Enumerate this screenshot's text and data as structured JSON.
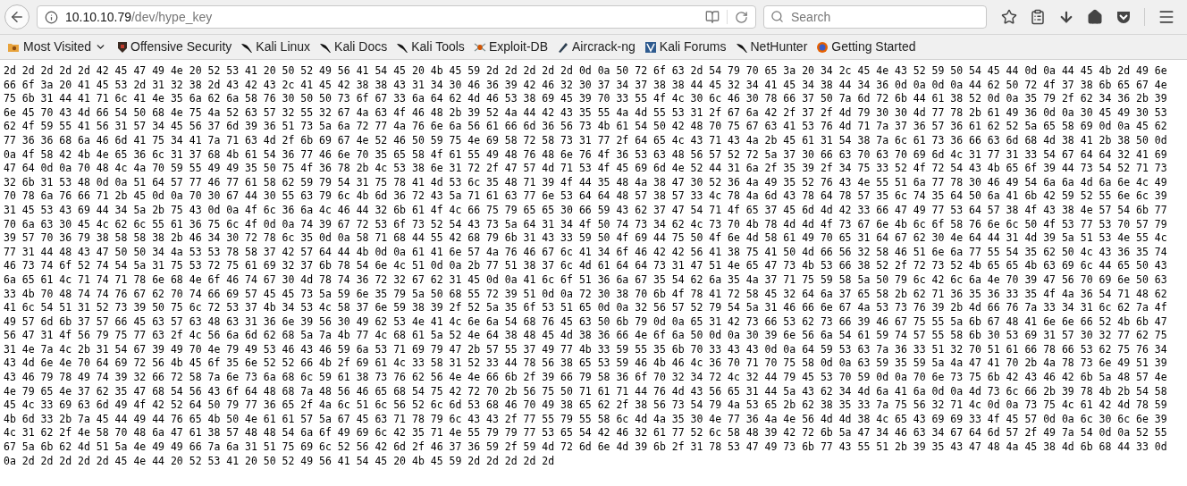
{
  "toolbar": {
    "url_host": "10.10.10.79",
    "url_path": "/dev/hype_key",
    "search_placeholder": "Search"
  },
  "bookmarks": [
    {
      "kind": "folder",
      "label": "Most Visited"
    },
    {
      "kind": "link",
      "label": "Offensive Security"
    },
    {
      "kind": "link",
      "label": "Kali Linux"
    },
    {
      "kind": "link",
      "label": "Kali Docs"
    },
    {
      "kind": "link",
      "label": "Kali Tools"
    },
    {
      "kind": "link",
      "label": "Exploit-DB"
    },
    {
      "kind": "link",
      "label": "Aircrack-ng"
    },
    {
      "kind": "link",
      "label": "Kali Forums"
    },
    {
      "kind": "link",
      "label": "NetHunter"
    },
    {
      "kind": "link",
      "label": "Getting Started"
    }
  ],
  "content_lines": [
    "2d 2d 2d 2d 2d 42 45 47 49 4e 20 52 53 41 20 50 52 49 56 41 54 45 20 4b 45 59 2d 2d 2d 2d 2d 0d 0a 50 72 6f 63 2d 54 79 70 65 3a 20 34 2c 45 4e 43 52 59 50 54 45 44 0d 0a 44 45 4b 2d 49 6e",
    "66 6f 3a 20 41 45 53 2d 31 32 38 2d 43 42 43 2c 41 45 42 38 38 43 31 34 30 46 36 39 42 46 32 30 37 34 37 38 38 44 45 32 34 41 45 34 38 44 34 36 0d 0a 0d 0a 44 62 50 72 4f 37 38 6b 65 67 4e",
    "75 6b 31 44 41 71 6c 41 4e 35 6a 62 6a 58 76 30 50 50 73 6f 67 33 6a 64 62 4d 46 53 38 69 45 39 70 33 55 4f 4c 30 6c 46 30 78 66 37 50 7a 6d 72 6b 44 61 38 52 0d 0a 35 79 2f 62 34 36 2b 39",
    "6e 45 70 43 4d 66 54 50 68 4e 75 4a 52 63 57 32 55 32 67 4a 63 4f 46 48 2b 39 52 4a 44 42 43 35 55 4a 4d 55 53 31 2f 67 6a 42 2f 37 2f 4d 79 30 30 4d 77 78 2b 61 49 36 0d 0a 30 45 49 30 53",
    "62 4f 59 55 41 56 31 57 34 45 56 37 6d 39 36 51 73 5a 6a 72 77 4a 76 6e 6a 56 61 66 6d 36 56 73 4b 61 54 50 42 48 70 75 67 63 41 53 76 4d 71 7a 37 36 57 36 61 62 52 5a 65 58 69 0d 0a 45 62",
    "77 36 36 68 6a 46 6d 41 75 34 41 7a 71 63 4d 2f 6b 69 67 4e 52 46 50 59 75 4e 69 58 72 58 73 31 77 2f 64 65 4c 43 71 43 4a 2b 45 61 31 54 38 7a 6c 61 73 36 66 63 6d 68 4d 38 41 2b 38 50 0d",
    "0a 4f 58 42 4b 4e 65 36 6c 31 37 68 4b 61 54 36 77 46 6e 70 35 65 58 4f 61 55 49 48 76 48 6e 76 4f 36 53 63 48 56 57 52 72 5a 37 30 66 63 70 63 70 69 6d 4c 31 77 31 33 54 67 64 64 32 41 69",
    "47 64 0d 0a 70 48 4c 4a 70 59 55 49 49 35 50 75 4f 36 78 2b 4c 53 38 6e 31 72 2f 47 57 4d 71 53 4f 45 69 6d 4e 52 44 31 6a 2f 35 39 2f 34 75 33 52 4f 72 54 43 4b 65 6f 39 44 73 54 52 71 73",
    "32 6b 31 53 48 0d 0a 51 64 57 77 46 77 61 58 62 59 79 54 31 75 78 41 4d 53 6c 35 48 71 39 4f 44 35 48 4a 38 47 30 52 36 4a 49 35 52 76 43 4e 55 51 6a 77 78 30 46 49 54 6a 6a 4d 6a 6e 4c 49",
    "70 78 6a 76 66 71 2b 45 0d 0a 70 30 67 44 30 55 63 79 6c 4b 6d 36 72 43 5a 71 61 63 77 6e 53 64 64 48 57 38 57 33 4c 78 4a 6d 43 78 64 78 57 35 6c 74 35 64 50 6a 41 6b 42 59 52 55 6e 6c 39",
    "31 45 53 43 69 44 34 5a 2b 75 43 0d 0a 4f 6c 36 6a 4c 46 44 32 6b 61 4f 4c 66 75 79 65 65 30 66 59 43 62 37 47 54 71 4f 65 37 45 6d 4d 42 33 66 47 49 77 53 64 57 38 4f 43 38 4e 57 54 6b 77",
    "70 6a 63 30 45 4c 62 6c 55 61 36 75 6c 4f 0d 0a 74 39 67 72 53 6f 73 52 54 43 73 5a 64 31 34 4f 50 74 73 34 62 4c 73 70 4b 78 4d 4d 4f 73 67 6e 4b 6c 6f 58 76 6e 6c 50 4f 53 77 53 70 57 79",
    "39 57 70 36 79 38 58 58 38 2b 46 34 30 72 78 6c 35 0d 0a 58 71 68 44 55 42 68 79 6b 31 43 33 59 50 4f 69 44 75 50 4f 6e 4d 58 61 49 70 65 31 64 67 62 30 4e 64 44 31 4d 39 5a 51 53 4e 55 4c",
    "77 31 44 48 43 47 50 50 34 4a 53 53 78 58 37 42 57 64 44 4b 0d 0a 61 41 6e 57 4a 76 46 67 6c 41 34 6f 46 42 42 56 41 38 75 41 50 4d 66 56 32 58 46 51 6e 6a 77 55 54 35 62 50 4c 43 36 35 74",
    "46 73 74 6f 52 74 54 5a 31 75 53 72 75 61 69 32 37 6b 78 54 6e 4c 51 0d 0a 2b 77 51 38 37 6c 4d 61 64 64 73 31 47 51 4e 65 47 73 4b 53 66 38 52 2f 72 73 52 4b 65 65 4b 63 69 6c 44 65 50 43",
    "6a 65 61 4c 71 74 71 78 6e 68 4e 6f 46 74 67 30 4d 78 74 36 72 32 67 62 31 45 0d 0a 41 6c 6f 51 36 6a 67 35 54 62 6a 35 4a 37 71 75 59 58 5a 50 79 6c 42 6c 6a 4e 70 39 47 56 70 69 6e 50 63",
    "33 4b 70 48 74 74 76 67 62 70 74 66 69 57 45 45 73 5a 59 6e 35 79 5a 50 68 55 72 39 51 0d 0a 72 30 38 70 6b 4f 78 41 72 58 45 32 64 6a 37 65 58 2b 62 71 36 35 36 33 35 4f 4a 36 54 71 48 62",
    "41 6c 54 51 31 52 73 39 50 75 6c 72 53 37 4b 34 53 4c 58 37 6e 59 38 39 2f 52 5a 35 6f 53 51 65 0d 0a 32 56 57 52 79 54 5a 31 46 66 6e 67 4a 53 73 76 39 2b 4d 66 76 7a 33 34 31 6c 62 7a 4f",
    "49 57 6d 6b 37 57 66 45 63 57 63 48 63 31 36 6e 39 56 30 49 62 53 4e 41 4c 6e 6a 54 68 76 45 63 50 6b 79 0d 0a 65 31 42 73 66 53 62 73 66 39 46 67 75 55 5a 6b 67 48 41 6e 6e 66 52 4b 6b 47",
    "56 47 31 4f 56 79 75 77 63 2f 4c 56 6a 6d 62 68 5a 7a 4b 77 4c 68 61 5a 52 4e 64 38 48 45 4d 38 36 66 4e 6f 6a 50 0d 0a 30 39 6e 56 6a 54 61 59 74 57 55 58 6b 30 53 69 31 57 30 32 77 62 75",
    "31 4e 7a 4c 2b 31 54 67 39 49 70 4e 79 49 53 46 43 46 59 6a 53 71 69 79 47 2b 57 55 37 49 77 4b 33 59 55 35 6b 70 33 43 43 0d 0a 64 59 53 63 7a 36 33 51 32 70 51 61 66 78 66 53 62 75 76 34",
    "43 4d 6e 4e 70 64 69 72 56 4b 45 6f 35 6e 52 52 66 4b 2f 69 61 4c 33 58 31 52 33 44 78 56 38 65 53 59 46 4b 46 4c 36 70 71 70 75 58 0d 0a 63 59 35 59 5a 4a 47 41 70 2b 4a 78 73 6e 49 51 39",
    "43 46 79 78 49 74 39 32 66 72 58 7a 6e 73 6a 68 6c 59 61 38 73 76 62 56 4e 4e 66 6b 2f 39 66 79 58 36 6f 70 32 34 72 4c 32 44 79 45 53 70 59 0d 0a 70 6e 73 75 6b 42 43 46 42 6b 5a 48 57 4e",
    "4e 79 65 4e 37 62 35 47 68 54 56 43 6f 64 48 68 7a 48 56 46 65 68 54 75 42 72 70 2b 56 75 50 71 61 71 44 76 4d 43 56 65 31 44 5a 43 62 34 4d 6a 41 6a 0d 0a 4d 73 6c 66 2b 39 78 4b 2b 54 58",
    "45 4c 33 69 63 6d 49 4f 42 52 64 50 79 77 36 65 2f 4a 6c 51 6c 56 52 6c 6d 53 68 46 70 49 38 65 62 2f 38 56 73 54 79 4a 53 65 2b 62 38 35 33 7a 75 56 32 71 4c 0d 0a 73 75 4c 61 42 4d 78 59",
    "4b 6d 33 2b 7a 45 44 49 44 76 65 4b 50 4e 61 61 57 5a 67 45 63 71 78 79 6c 43 43 2f 77 55 79 55 58 6c 4d 4a 35 30 4e 77 36 4a 4e 56 4d 4d 38 4c 65 43 69 69 33 4f 45 57 0d 0a 6c 30 6c 6e 39",
    "4c 31 62 2f 4e 58 70 48 6a 47 61 38 57 48 48 54 6a 6f 49 69 6c 42 35 71 4e 55 79 79 77 53 65 54 42 46 32 61 77 52 6c 58 48 39 42 72 6b 5a 47 34 46 63 34 67 64 6d 57 2f 49 7a 54 0d 0a 52 55",
    "67 5a 6b 62 4d 51 5a 4e 49 49 66 7a 6a 31 51 75 69 6c 52 56 42 6d 2f 46 37 36 59 2f 59 4d 72 6d 6e 4d 39 6b 2f 31 78 53 47 49 73 6b 77 43 55 51 2b 39 35 43 47 48 4a 45 38 4d 6b 68 44 33 0d",
    "0a 2d 2d 2d 2d 2d 45 4e 44 20 52 53 41 20 50 52 49 56 41 54 45 20 4b 45 59 2d 2d 2d 2d 2d"
  ]
}
